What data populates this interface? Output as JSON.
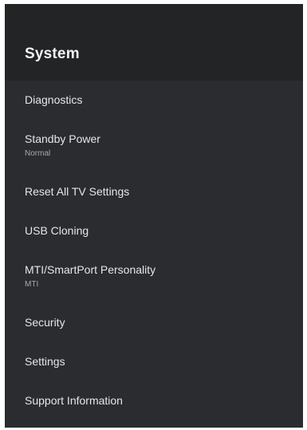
{
  "panel": {
    "title": "System"
  },
  "menu": {
    "items": [
      {
        "label": "Diagnostics"
      },
      {
        "label": "Standby Power",
        "subtitle": "Normal"
      },
      {
        "label": "Reset All TV Settings"
      },
      {
        "label": "USB Cloning"
      },
      {
        "label": "MTI/SmartPort Personality",
        "subtitle": "MTI"
      },
      {
        "label": "Security"
      },
      {
        "label": "Settings"
      },
      {
        "label": "Support Information"
      }
    ]
  }
}
